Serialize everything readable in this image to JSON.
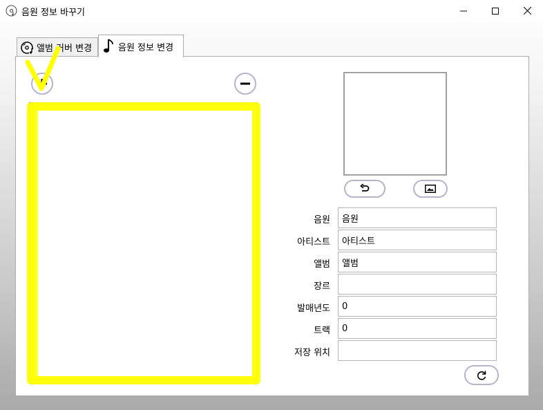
{
  "window": {
    "title": "음원 정보 바꾸기",
    "icon": "music-disc-icon",
    "controls": [
      "minimize-icon",
      "maximize-icon",
      "close-icon"
    ]
  },
  "tabs": [
    {
      "label": "앨범 커버 변경",
      "icon": "disc-music-icon",
      "selected": false
    },
    {
      "label": "음원 정보 변경",
      "icon": "music-note-icon",
      "selected": true
    }
  ],
  "list": {
    "add_icon": "plus-icon",
    "remove_icon": "minus-icon",
    "items": [],
    "highlight_color": "#ffff00"
  },
  "cover": {
    "undo_icon": "undo-icon",
    "image_icon": "image-icon"
  },
  "fields": [
    {
      "label": "음원",
      "value": "음원"
    },
    {
      "label": "아티스트",
      "value": "아티스트"
    },
    {
      "label": "앨범",
      "value": "앨범"
    },
    {
      "label": "장르",
      "value": ""
    },
    {
      "label": "발매년도",
      "value": "0"
    },
    {
      "label": "트랙",
      "value": "0"
    },
    {
      "label": "저장 위치",
      "value": ""
    }
  ],
  "refresh_icon": "refresh-icon"
}
